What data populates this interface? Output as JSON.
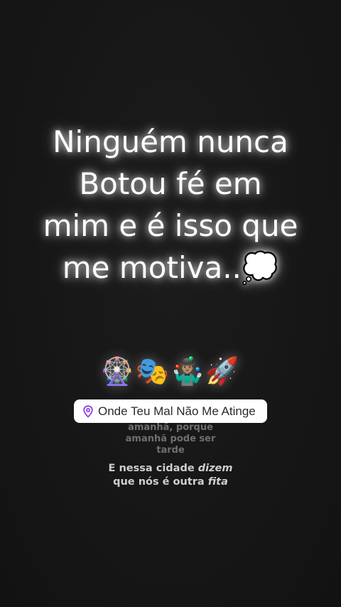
{
  "quote": {
    "lines": [
      "Ninguém nunca",
      "Botou fé em",
      "mim e é isso que",
      "me motiva..💭"
    ]
  },
  "emojis": "🎡🎭🤹🏽‍♂️🚀",
  "location": {
    "icon": "location-pin-icon",
    "label": "Onde Teu Mal Não Me Atinge",
    "pin_color": "#8e3fe0"
  },
  "lyrics": {
    "previous_lines": [
      "amanhã, porque",
      "amanhã pode ser",
      "tarde"
    ],
    "current_line_1_part_a": "E nessa cidade ",
    "current_line_1_part_b": "dizem",
    "current_line_2_part_a": "que nós é outra ",
    "current_line_2_part_b": "fita"
  }
}
